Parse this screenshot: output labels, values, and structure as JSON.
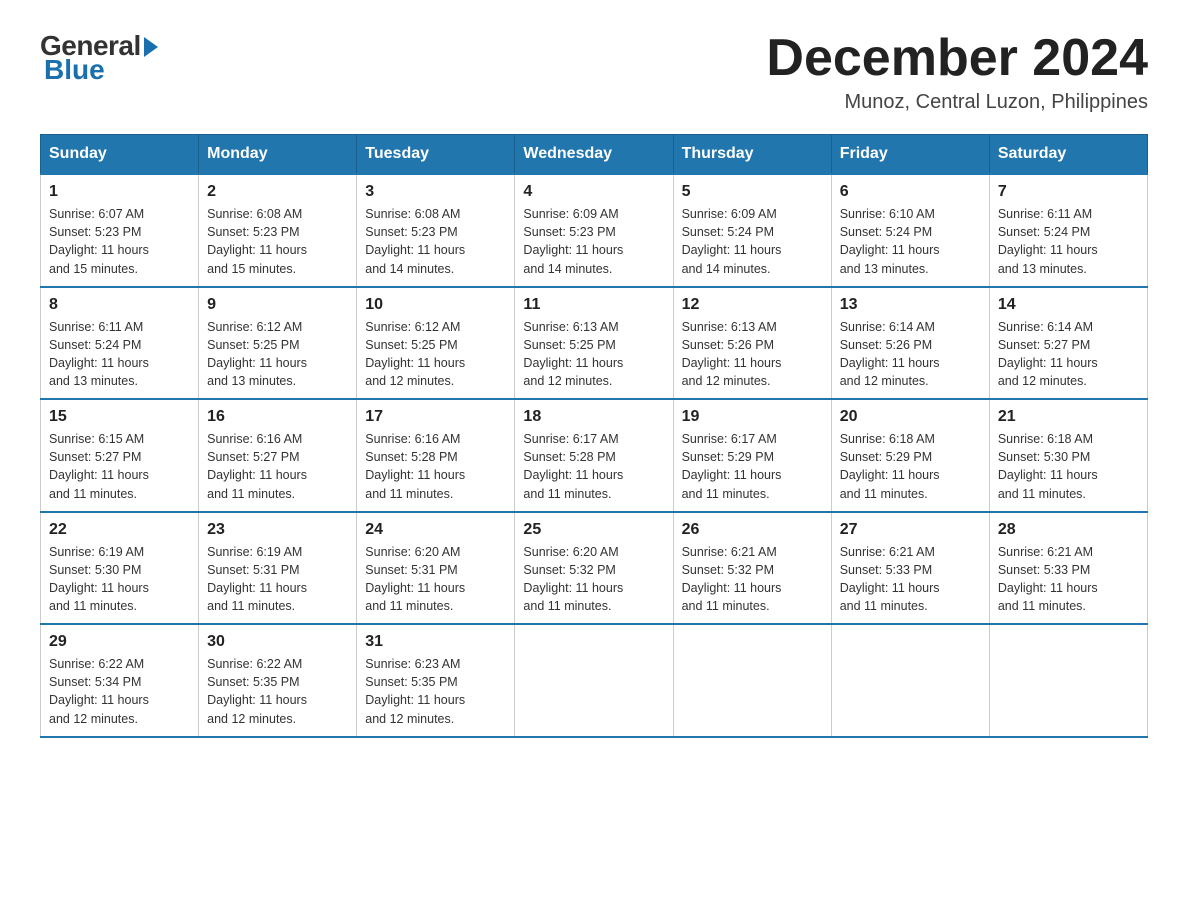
{
  "header": {
    "logo_general": "General",
    "logo_blue": "Blue",
    "month_title": "December 2024",
    "subtitle": "Munoz, Central Luzon, Philippines"
  },
  "days_of_week": [
    "Sunday",
    "Monday",
    "Tuesday",
    "Wednesday",
    "Thursday",
    "Friday",
    "Saturday"
  ],
  "weeks": [
    [
      {
        "day": "1",
        "sunrise": "6:07 AM",
        "sunset": "5:23 PM",
        "daylight": "11 hours and 15 minutes."
      },
      {
        "day": "2",
        "sunrise": "6:08 AM",
        "sunset": "5:23 PM",
        "daylight": "11 hours and 15 minutes."
      },
      {
        "day": "3",
        "sunrise": "6:08 AM",
        "sunset": "5:23 PM",
        "daylight": "11 hours and 14 minutes."
      },
      {
        "day": "4",
        "sunrise": "6:09 AM",
        "sunset": "5:23 PM",
        "daylight": "11 hours and 14 minutes."
      },
      {
        "day": "5",
        "sunrise": "6:09 AM",
        "sunset": "5:24 PM",
        "daylight": "11 hours and 14 minutes."
      },
      {
        "day": "6",
        "sunrise": "6:10 AM",
        "sunset": "5:24 PM",
        "daylight": "11 hours and 13 minutes."
      },
      {
        "day": "7",
        "sunrise": "6:11 AM",
        "sunset": "5:24 PM",
        "daylight": "11 hours and 13 minutes."
      }
    ],
    [
      {
        "day": "8",
        "sunrise": "6:11 AM",
        "sunset": "5:24 PM",
        "daylight": "11 hours and 13 minutes."
      },
      {
        "day": "9",
        "sunrise": "6:12 AM",
        "sunset": "5:25 PM",
        "daylight": "11 hours and 13 minutes."
      },
      {
        "day": "10",
        "sunrise": "6:12 AM",
        "sunset": "5:25 PM",
        "daylight": "11 hours and 12 minutes."
      },
      {
        "day": "11",
        "sunrise": "6:13 AM",
        "sunset": "5:25 PM",
        "daylight": "11 hours and 12 minutes."
      },
      {
        "day": "12",
        "sunrise": "6:13 AM",
        "sunset": "5:26 PM",
        "daylight": "11 hours and 12 minutes."
      },
      {
        "day": "13",
        "sunrise": "6:14 AM",
        "sunset": "5:26 PM",
        "daylight": "11 hours and 12 minutes."
      },
      {
        "day": "14",
        "sunrise": "6:14 AM",
        "sunset": "5:27 PM",
        "daylight": "11 hours and 12 minutes."
      }
    ],
    [
      {
        "day": "15",
        "sunrise": "6:15 AM",
        "sunset": "5:27 PM",
        "daylight": "11 hours and 11 minutes."
      },
      {
        "day": "16",
        "sunrise": "6:16 AM",
        "sunset": "5:27 PM",
        "daylight": "11 hours and 11 minutes."
      },
      {
        "day": "17",
        "sunrise": "6:16 AM",
        "sunset": "5:28 PM",
        "daylight": "11 hours and 11 minutes."
      },
      {
        "day": "18",
        "sunrise": "6:17 AM",
        "sunset": "5:28 PM",
        "daylight": "11 hours and 11 minutes."
      },
      {
        "day": "19",
        "sunrise": "6:17 AM",
        "sunset": "5:29 PM",
        "daylight": "11 hours and 11 minutes."
      },
      {
        "day": "20",
        "sunrise": "6:18 AM",
        "sunset": "5:29 PM",
        "daylight": "11 hours and 11 minutes."
      },
      {
        "day": "21",
        "sunrise": "6:18 AM",
        "sunset": "5:30 PM",
        "daylight": "11 hours and 11 minutes."
      }
    ],
    [
      {
        "day": "22",
        "sunrise": "6:19 AM",
        "sunset": "5:30 PM",
        "daylight": "11 hours and 11 minutes."
      },
      {
        "day": "23",
        "sunrise": "6:19 AM",
        "sunset": "5:31 PM",
        "daylight": "11 hours and 11 minutes."
      },
      {
        "day": "24",
        "sunrise": "6:20 AM",
        "sunset": "5:31 PM",
        "daylight": "11 hours and 11 minutes."
      },
      {
        "day": "25",
        "sunrise": "6:20 AM",
        "sunset": "5:32 PM",
        "daylight": "11 hours and 11 minutes."
      },
      {
        "day": "26",
        "sunrise": "6:21 AM",
        "sunset": "5:32 PM",
        "daylight": "11 hours and 11 minutes."
      },
      {
        "day": "27",
        "sunrise": "6:21 AM",
        "sunset": "5:33 PM",
        "daylight": "11 hours and 11 minutes."
      },
      {
        "day": "28",
        "sunrise": "6:21 AM",
        "sunset": "5:33 PM",
        "daylight": "11 hours and 11 minutes."
      }
    ],
    [
      {
        "day": "29",
        "sunrise": "6:22 AM",
        "sunset": "5:34 PM",
        "daylight": "11 hours and 12 minutes."
      },
      {
        "day": "30",
        "sunrise": "6:22 AM",
        "sunset": "5:35 PM",
        "daylight": "11 hours and 12 minutes."
      },
      {
        "day": "31",
        "sunrise": "6:23 AM",
        "sunset": "5:35 PM",
        "daylight": "11 hours and 12 minutes."
      },
      null,
      null,
      null,
      null
    ]
  ],
  "labels": {
    "sunrise": "Sunrise:",
    "sunset": "Sunset:",
    "daylight": "Daylight:"
  }
}
